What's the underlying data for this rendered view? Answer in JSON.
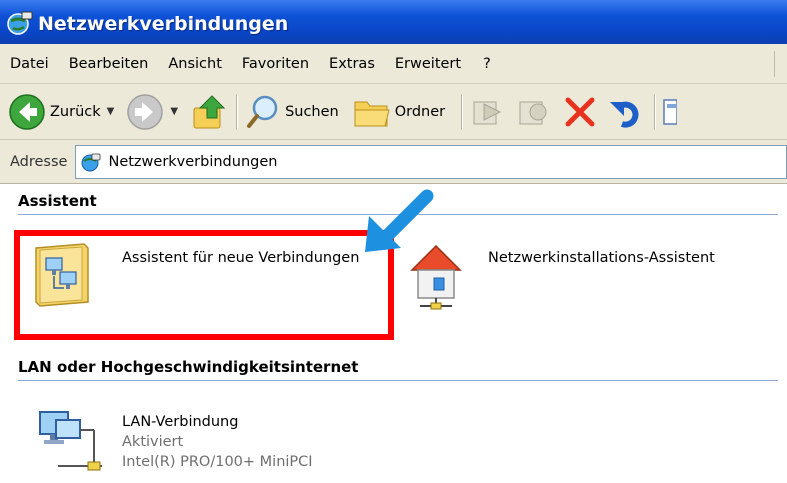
{
  "window": {
    "title": "Netzwerkverbindungen"
  },
  "menu": [
    "Datei",
    "Bearbeiten",
    "Ansicht",
    "Favoriten",
    "Extras",
    "Erweitert",
    "?"
  ],
  "toolbar": {
    "back_label": "Zurück",
    "search_label": "Suchen",
    "folders_label": "Ordner"
  },
  "address": {
    "label": "Adresse",
    "value": "Netzwerkverbindungen"
  },
  "groups": {
    "assistant": {
      "header": "Assistent",
      "items": [
        {
          "label": "Assistent für neue Verbindungen",
          "icon": "new-connection-wizard-icon"
        },
        {
          "label": "Netzwerkinstallations-Assistent",
          "icon": "network-setup-house-icon"
        }
      ]
    },
    "lan": {
      "header": "LAN oder Hochgeschwindigkeitsinternet",
      "items": [
        {
          "label": "LAN-Verbindung",
          "status": "Aktiviert",
          "device": "Intel(R) PRO/100+ MiniPCI",
          "icon": "lan-connection-icon"
        }
      ]
    }
  },
  "colors": {
    "titlebar": "#0a47c8",
    "highlight": "#ff0000",
    "pointer_arrow": "#1e90e0",
    "chrome": "#ece9d8"
  }
}
